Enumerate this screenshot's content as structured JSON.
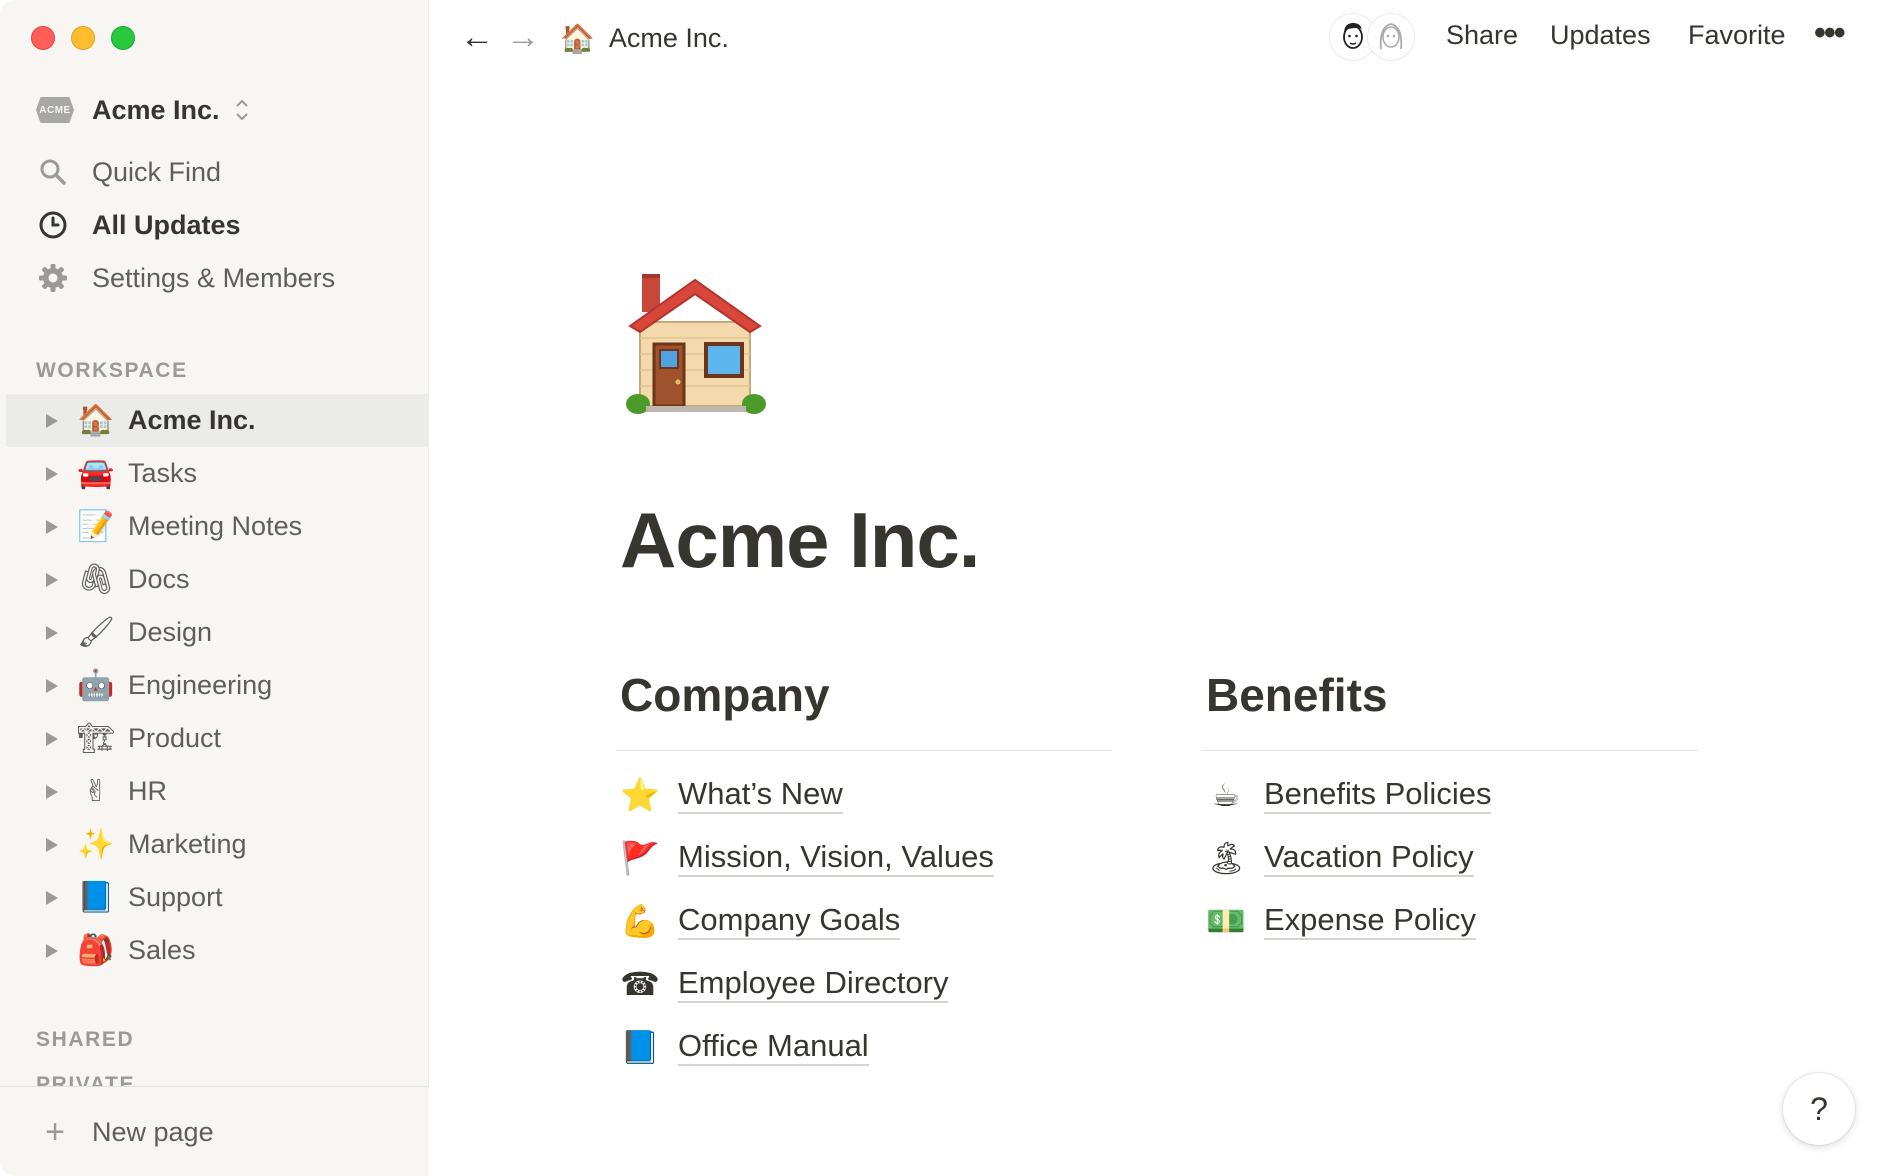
{
  "window": {
    "title": "Acme Inc."
  },
  "sidebar": {
    "workspace": {
      "logo_text": "ACME",
      "name": "Acme Inc.",
      "switcher_icon": "chevron-up-down-icon"
    },
    "nav": [
      {
        "label": "Quick Find",
        "icon": "search-icon"
      },
      {
        "label": "All Updates",
        "icon": "clock-icon"
      },
      {
        "label": "Settings & Members",
        "icon": "gear-icon"
      }
    ],
    "workspace_label": "WORKSPACE",
    "pages": [
      {
        "emoji": "🏠",
        "label": "Acme Inc.",
        "active": true
      },
      {
        "emoji": "🚘",
        "label": "Tasks"
      },
      {
        "emoji": "📝",
        "label": "Meeting Notes"
      },
      {
        "emoji": "🖇",
        "label": "Docs"
      },
      {
        "emoji": "🖌",
        "label": "Design"
      },
      {
        "emoji": "🤖",
        "label": "Engineering"
      },
      {
        "emoji": "🏗",
        "label": "Product"
      },
      {
        "emoji": "✌",
        "label": "HR"
      },
      {
        "emoji": "✨",
        "label": "Marketing"
      },
      {
        "emoji": "📘",
        "label": "Support"
      },
      {
        "emoji": "🎒",
        "label": "Sales"
      }
    ],
    "shared_label": "SHARED",
    "private_label": "PRIVATE",
    "new_page": "New page"
  },
  "topbar": {
    "back": "←",
    "forward": "→",
    "breadcrumb_emoji": "🏠",
    "breadcrumb": "Acme Inc.",
    "share": "Share",
    "updates": "Updates",
    "favorite": "Favorite",
    "more": "•••"
  },
  "page": {
    "icon": "house-icon",
    "title": "Acme Inc.",
    "columns": [
      {
        "heading": "Company",
        "links": [
          {
            "emoji": "⭐",
            "label": "What’s New"
          },
          {
            "emoji": "🚩",
            "label": "Mission, Vision, Values"
          },
          {
            "emoji": "💪",
            "label": "Company Goals"
          },
          {
            "emoji": "☎",
            "label": "Employee Directory"
          },
          {
            "emoji": "📘",
            "label": "Office Manual"
          }
        ]
      },
      {
        "heading": "Benefits",
        "links": [
          {
            "emoji": "☕",
            "label": "Benefits Policies"
          },
          {
            "emoji": "🏝",
            "label": "Vacation Policy"
          },
          {
            "emoji": "💵",
            "label": "Expense Policy"
          }
        ]
      }
    ]
  },
  "help": "?"
}
